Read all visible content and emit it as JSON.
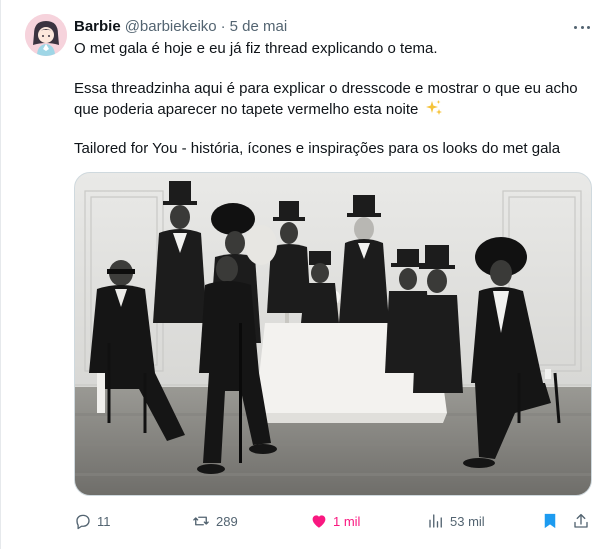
{
  "tweet": {
    "author": {
      "display_name": "Barbie",
      "handle": "@barbiekeiko",
      "separator": "·",
      "timestamp": "5 de mai"
    },
    "body": {
      "line1": "O met gala é hoje e eu já fiz thread explicando o tema.",
      "line2": "Essa threadzinha aqui é para explicar o dresscode e mostrar o que eu acho",
      "line3": "que poderia aparecer no tapete vermelho esta noite",
      "line4": "Tailored for You - história, ícones e inspirações para os looks do met gala"
    },
    "media": {
      "icon": "black-and-white-group-photo-formal-tailoring"
    },
    "actions": {
      "replies": "11",
      "retweets": "289",
      "likes": "1 mil",
      "views": "53 mil"
    },
    "colors": {
      "text": "#0f1419",
      "secondary": "#536471",
      "like": "#f91880",
      "bookmark": "#1d9bf0",
      "sparkle": "#f5c33b"
    }
  }
}
